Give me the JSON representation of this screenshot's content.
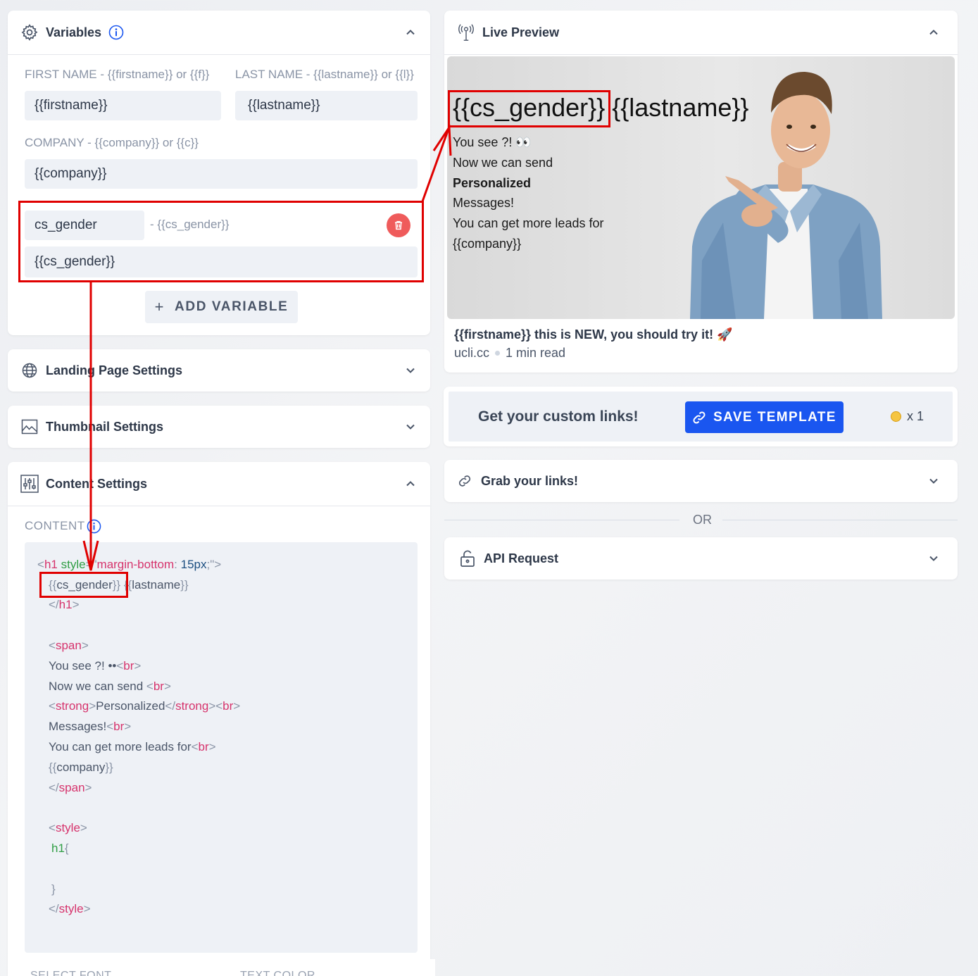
{
  "variables": {
    "title": "Variables",
    "firstname_label": "FIRST NAME - {{firstname}} or {{f}}",
    "firstname_value": "{{firstname}}",
    "lastname_label": "LAST NAME - {{lastname}} or {{l}}",
    "lastname_value": "{{lastname}}",
    "company_label": "COMPANY - {{company}} or {{c}}",
    "company_value": "{{company}}",
    "custom_name": "cs_gender",
    "custom_hint": "- {{cs_gender}}",
    "custom_value": "{{cs_gender}}",
    "add_button": "ADD VARIABLE"
  },
  "landing_settings": {
    "title": "Landing Page Settings"
  },
  "thumbnail_settings": {
    "title": "Thumbnail Settings"
  },
  "content_settings": {
    "title": "Content Settings",
    "content_label": "CONTENT",
    "footer_left": "SELECT FONT",
    "footer_right": "TEXT COLOR"
  },
  "preview": {
    "title": "Live Preview",
    "heading_var": "{{cs_gender}}",
    "heading_rest": "{{lastname}}",
    "lines": [
      "You see ?! 👀",
      "Now we can send",
      "Personalized",
      "Messages!",
      "You can get more leads for",
      "{{company}}"
    ],
    "caption": "{{firstname}} this is NEW, you should try it! 🚀",
    "domain": "ucli.cc",
    "read_time": "1 min read"
  },
  "cta": {
    "text": "Get your custom links!",
    "button": "SAVE TEMPLATE",
    "coins": "x 1"
  },
  "grab_links": {
    "title": "Grab your links!"
  },
  "or_text": "OR",
  "api_request": {
    "title": "API Request"
  },
  "colors": {
    "accent": "#1a56f0",
    "annotation": "#e00000",
    "delete": "#ef5b5b"
  }
}
